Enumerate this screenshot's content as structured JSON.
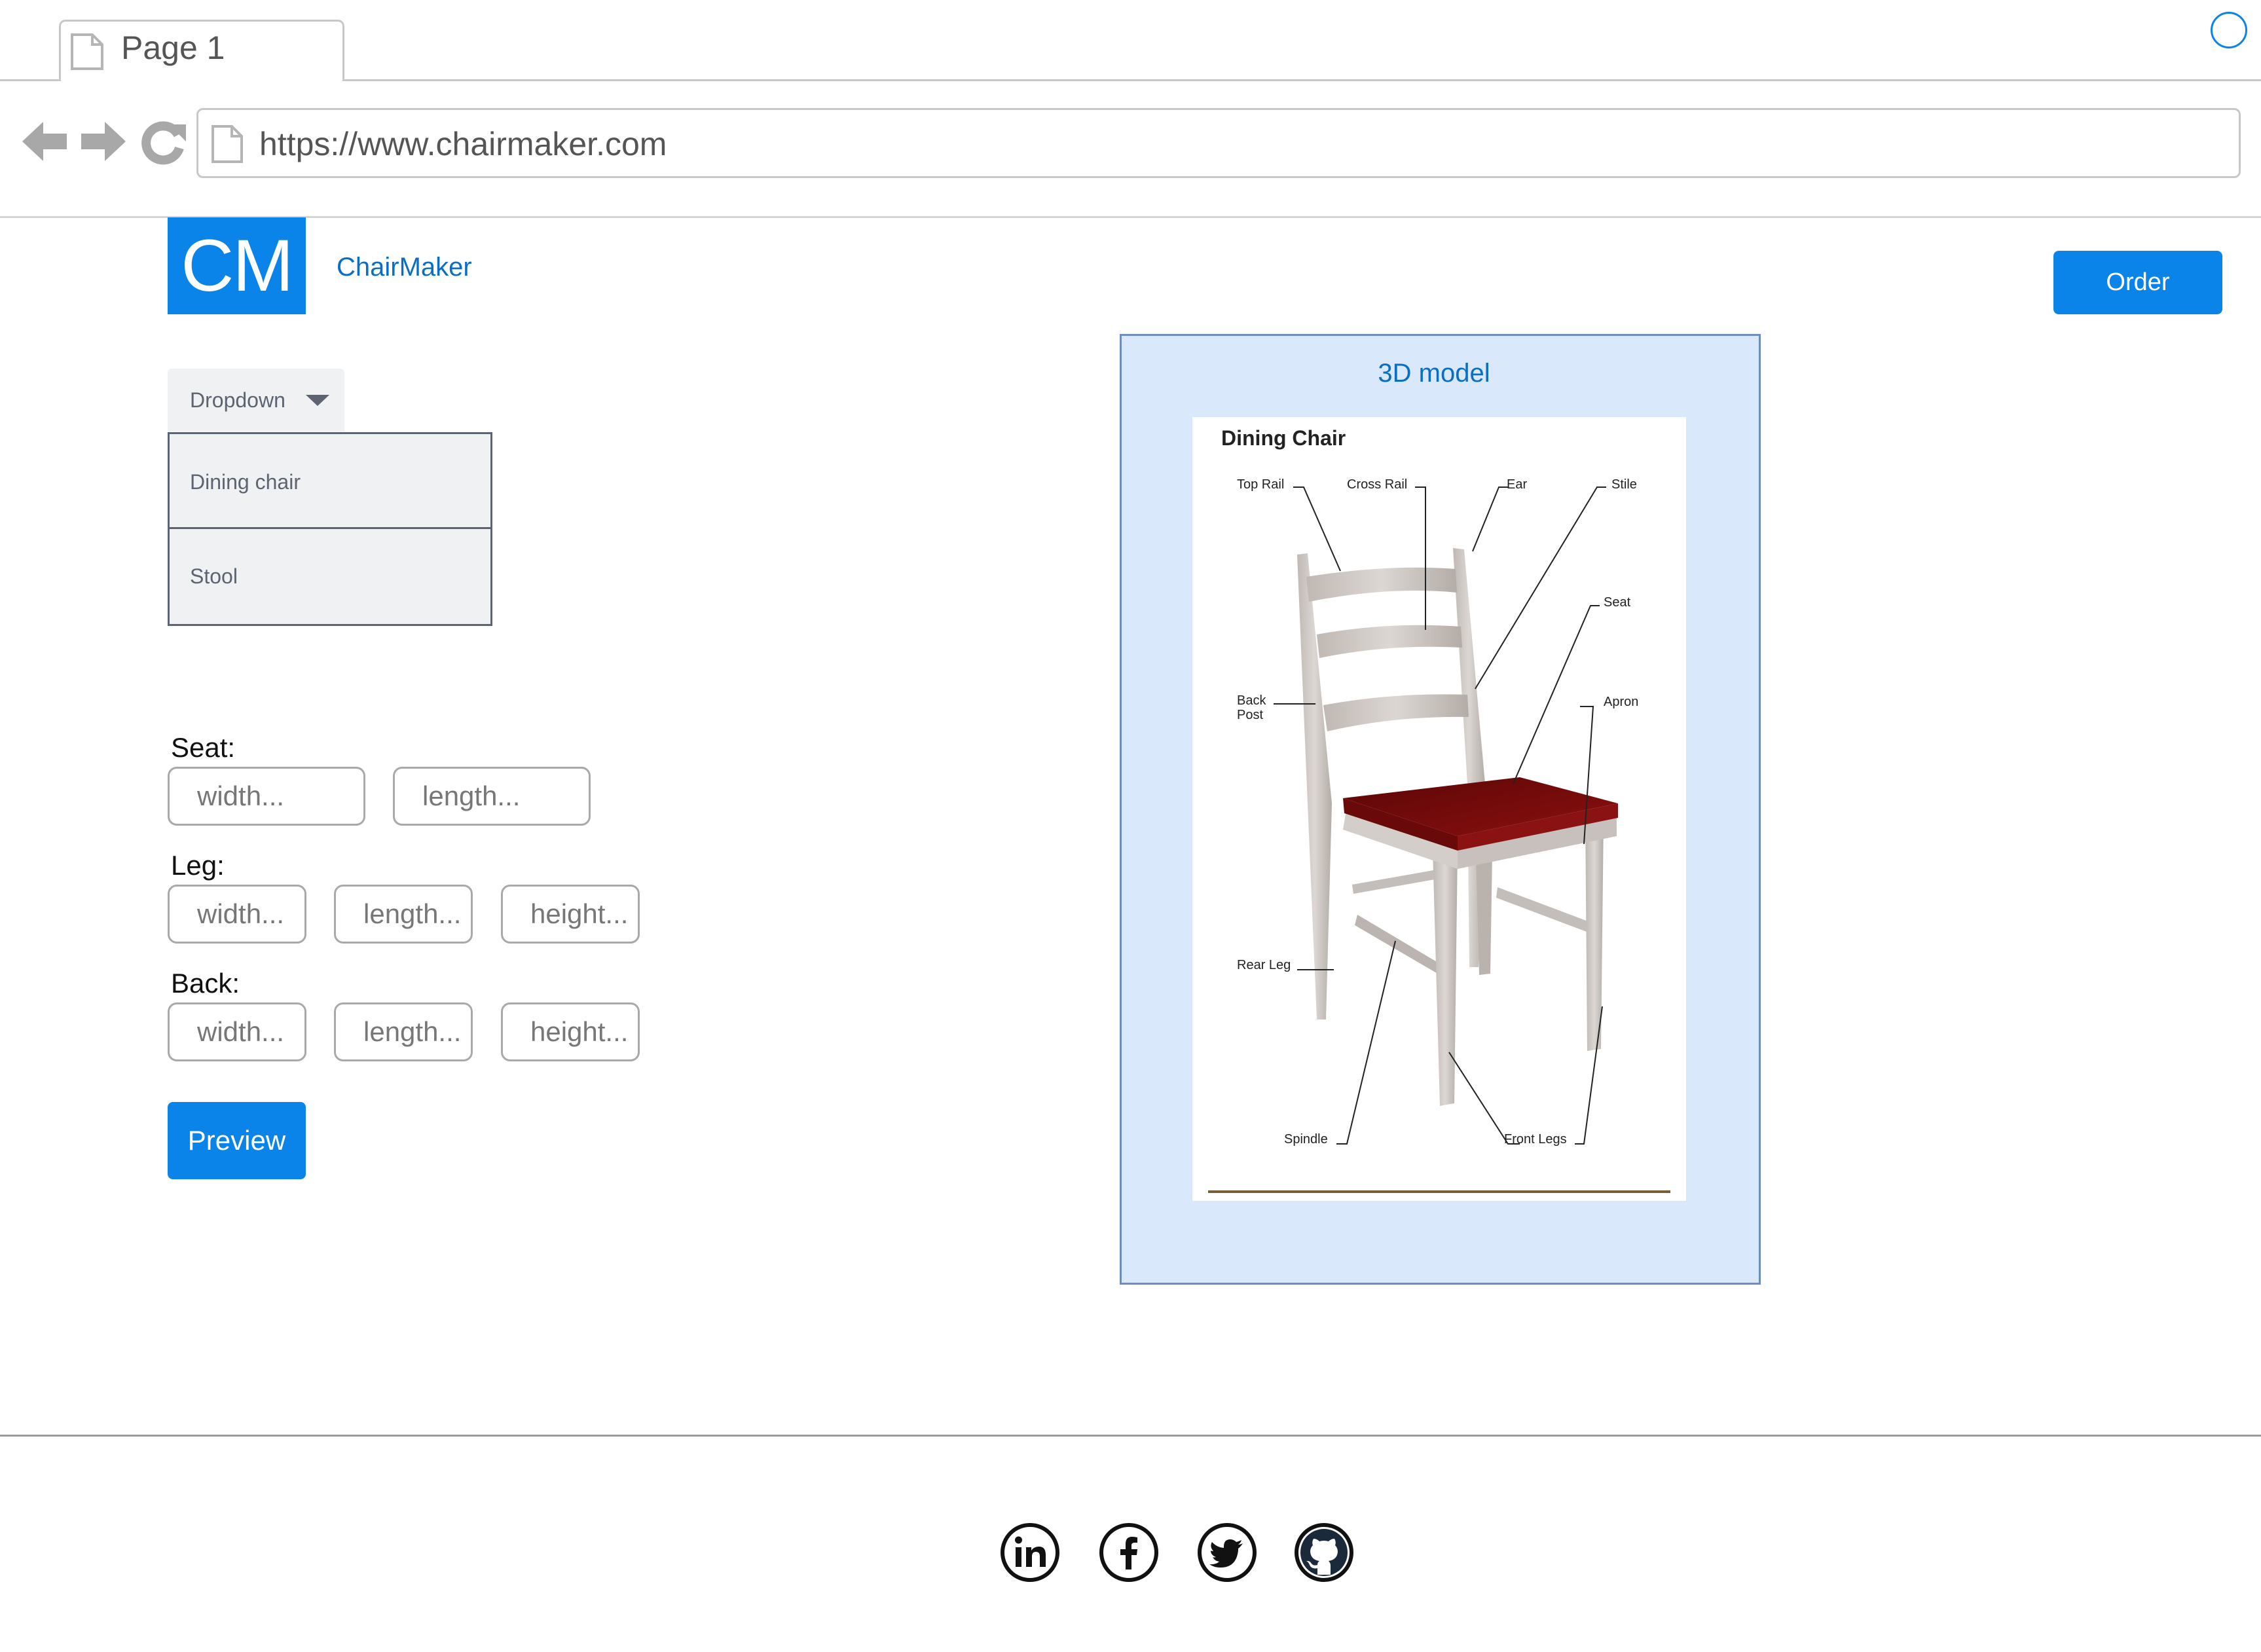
{
  "browser": {
    "tab_title": "Page 1",
    "url": "https://www.chairmaker.com"
  },
  "header": {
    "logo_text": "CM",
    "brand_name": "ChairMaker",
    "order_label": "Order"
  },
  "dropdown": {
    "label": "Dropdown",
    "options": [
      "Dining chair",
      "Stool"
    ]
  },
  "form": {
    "seat": {
      "label": "Seat:",
      "fields": [
        "width...",
        "length..."
      ]
    },
    "leg": {
      "label": "Leg:",
      "fields": [
        "width...",
        "length...",
        "height..."
      ]
    },
    "back": {
      "label": "Back:",
      "fields": [
        "width...",
        "length...",
        "height..."
      ]
    },
    "preview_label": "Preview"
  },
  "model": {
    "panel_title": "3D model",
    "figure_title": "Dining Chair",
    "parts": {
      "top_rail": "Top Rail",
      "cross_rail": "Cross Rail",
      "ear": "Ear",
      "stile": "Stile",
      "seat": "Seat",
      "back_post_1": "Back",
      "back_post_2": "Post",
      "apron": "Apron",
      "rear_leg": "Rear Leg",
      "spindle": "Spindle",
      "front_legs": "Front Legs"
    }
  },
  "footer": {
    "social_icons": [
      "linkedin-icon",
      "facebook-icon",
      "twitter-icon",
      "github-icon"
    ]
  },
  "colors": {
    "accent": "#0a84e8",
    "panel_bg": "#dae8fb",
    "panel_border": "#6c8ebf",
    "chair_wood": "#cdc6c2",
    "seat": "#7a0c0c"
  }
}
